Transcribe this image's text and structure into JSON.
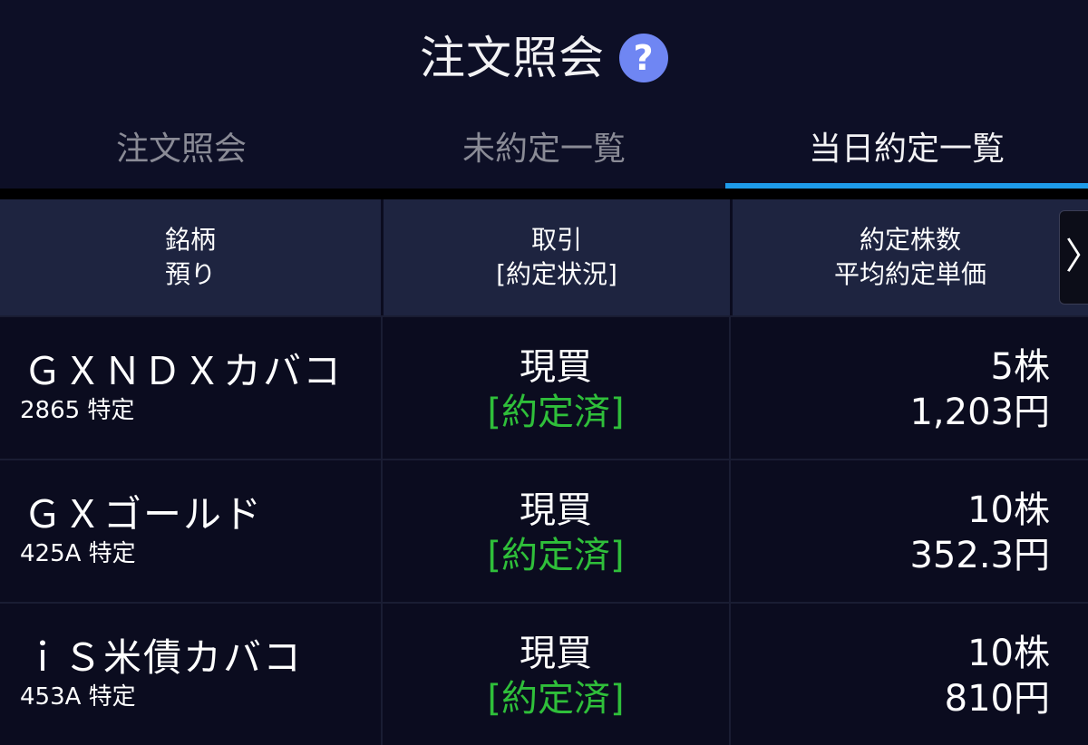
{
  "header": {
    "title": "注文照会",
    "help_icon": "question-icon",
    "help_glyph": "?"
  },
  "tabs": [
    {
      "label": "注文照会",
      "active": false
    },
    {
      "label": "未約定一覧",
      "active": false
    },
    {
      "label": "当日約定一覧",
      "active": true
    }
  ],
  "colors": {
    "accent": "#1e9bea",
    "help": "#6f86f3",
    "executed": "#2fbf3a",
    "header_bg": "#1e2440",
    "page_bg": "#0b0c1f"
  },
  "columns": [
    {
      "line1": "銘柄",
      "line2": "預り"
    },
    {
      "line1": "取引",
      "line2": "[約定状況]"
    },
    {
      "line1": "約定株数",
      "line2": "平均約定単価"
    }
  ],
  "scroll_indicator": "〉",
  "rows": [
    {
      "name": "ＧＸＮＤＸカバコ",
      "code_account": "2865 特定",
      "trade": "現買",
      "status": "[約定済]",
      "quantity": "5株",
      "avg_price": "1,203円"
    },
    {
      "name": "ＧＸゴールド",
      "code_account": "425A 特定",
      "trade": "現買",
      "status": "[約定済]",
      "quantity": "10株",
      "avg_price": "352.3円"
    },
    {
      "name": "ｉＳ米債カバコ",
      "code_account": "453A 特定",
      "trade": "現買",
      "status": "[約定済]",
      "quantity": "10株",
      "avg_price": "810円"
    }
  ]
}
